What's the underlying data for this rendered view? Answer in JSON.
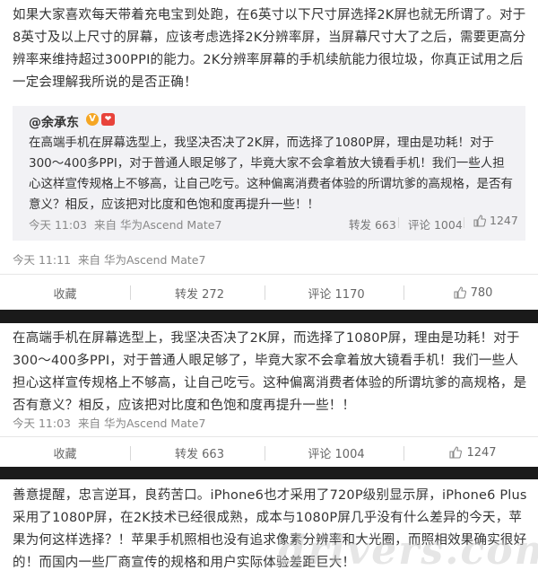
{
  "post1": {
    "text": "如果大家喜欢每天带着充电宝到处跑，在6英寸以下尺寸屏选择2K屏也就无所谓了。对于8英寸及以上尺寸的屏幕，应该考虑选择2K分辨率屏，当屏幕尺寸大了之后，需要更高分辨率来维持超过300PPI的能力。2K分辨率屏幕的手机续航能力很垃圾，你真正试用之后一定会理解我所说的是否正确！",
    "quote": {
      "author": "@余承东",
      "text": "在高端手机在屏幕选型上，我坚决否决了2K屏，而选择了1080P屏，理由是功耗！对于300～400多PPI，对于普通人眼足够了，毕竟大家不会拿着放大镜看手机！我们一些人担心这样宣传规格上不够高，让自己吃亏。这种偏离消费者体验的所谓坑爹的高规格，是否有意义？相反，应该把对比度和色饱和度再提升一些！！",
      "time": "今天 11:03",
      "source": "来自 华为Ascend Mate7",
      "repost": "转发 663",
      "comment": "评论 1004",
      "like": "1247"
    },
    "time": "今天 11:11",
    "source": "来自 华为Ascend Mate7",
    "actions": {
      "fav": "收藏",
      "repost": "转发 272",
      "comment": "评论 1170",
      "like": "780"
    }
  },
  "post2": {
    "text": "在高端手机在屏幕选型上，我坚决否决了2K屏，而选择了1080P屏，理由是功耗！对于300～400多PPI，对于普通人眼足够了，毕竟大家不会拿着放大镜看手机！我们一些人担心这样宣传规格上不够高，让自己吃亏。这种偏离消费者体验的所谓坑爹的高规格，是否有意义？相反，应该把对比度和色饱和度再提升一些！！",
    "time": "今天 11:03",
    "source": "来自 华为Ascend Mate7",
    "actions": {
      "fav": "收藏",
      "repost": "转发 663",
      "comment": "评论 1004",
      "like": "1247"
    }
  },
  "post3": {
    "text": "善意提醒，忠言逆耳，良药苦口。iPhone6也才采用了720P级别显示屏，iPhone6 Plus采用了1080P屏，在2K技术已经很成熟，成本与1080P屏几乎没有什么差异的今天，苹果为何这样选择？！苹果手机照相也没有追求像素分辨率和大光圈，而照相效果确实很好的！而国内一些厂商宣传的规格和用户实际体验差距巨大！"
  },
  "watermark": "drivers.com"
}
